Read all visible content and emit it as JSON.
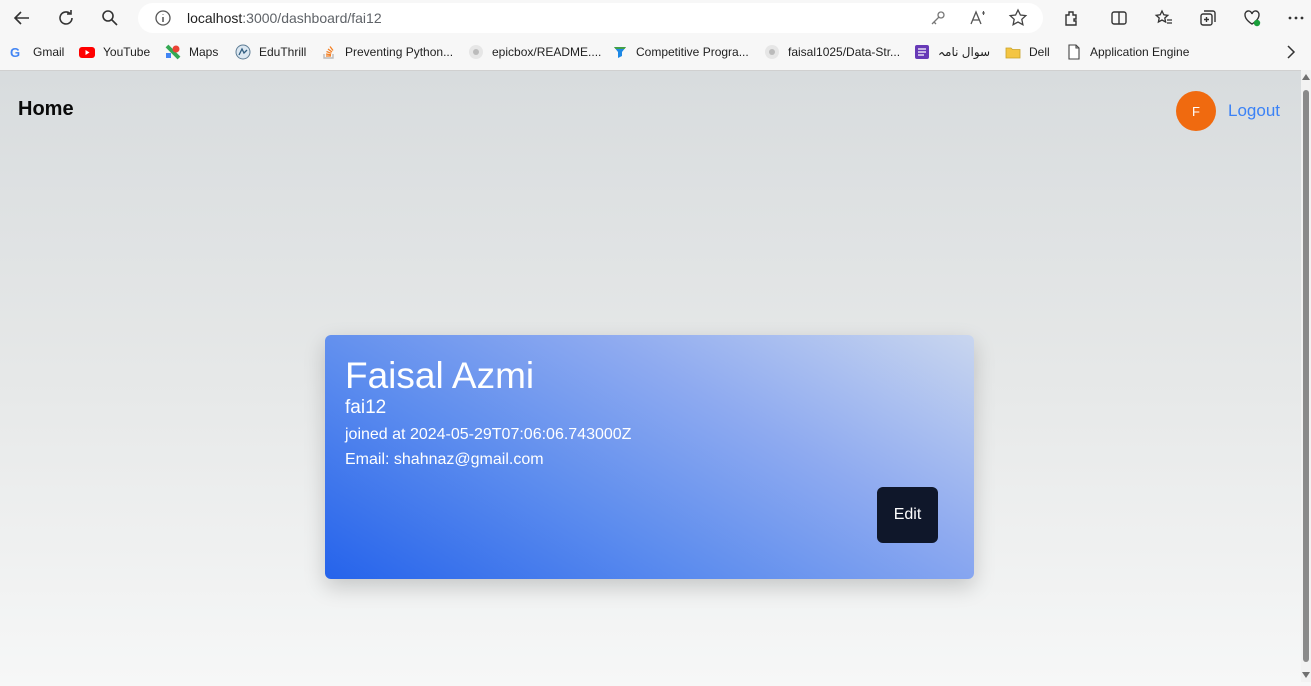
{
  "browser": {
    "url_host": "localhost",
    "url_path": ":3000/dashboard/fai12",
    "bookmarks": [
      {
        "label": "Gmail",
        "icon": "gmail-icon"
      },
      {
        "label": "YouTube",
        "icon": "youtube-icon"
      },
      {
        "label": "Maps",
        "icon": "maps-icon"
      },
      {
        "label": "EduThrill",
        "icon": "eduthrill-icon"
      },
      {
        "label": "Preventing Python...",
        "icon": "stackoverflow-icon"
      },
      {
        "label": "epicbox/README....",
        "icon": "github-icon"
      },
      {
        "label": "Competitive Progra...",
        "icon": "funnel-icon"
      },
      {
        "label": "faisal1025/Data-Str...",
        "icon": "github-icon"
      },
      {
        "label": "سوال نامہ",
        "icon": "form-icon"
      },
      {
        "label": "Dell",
        "icon": "folder-icon"
      },
      {
        "label": "Application Engine",
        "icon": "page-icon"
      }
    ]
  },
  "header": {
    "title": "Home",
    "avatar_initial": "F",
    "logout_label": "Logout"
  },
  "profile": {
    "name": "Faisal Azmi",
    "username": "fai12",
    "joined": "joined at 2024-05-29T07:06:06.743000Z",
    "email": "Email: shahnaz@gmail.com",
    "edit_label": "Edit"
  },
  "colors": {
    "avatar": "#f06a0f",
    "logout": "#3b82f6",
    "card_gradient_start": "#2563eb",
    "card_gradient_end": "#c9d6ef",
    "edit_button": "#0f172a"
  }
}
